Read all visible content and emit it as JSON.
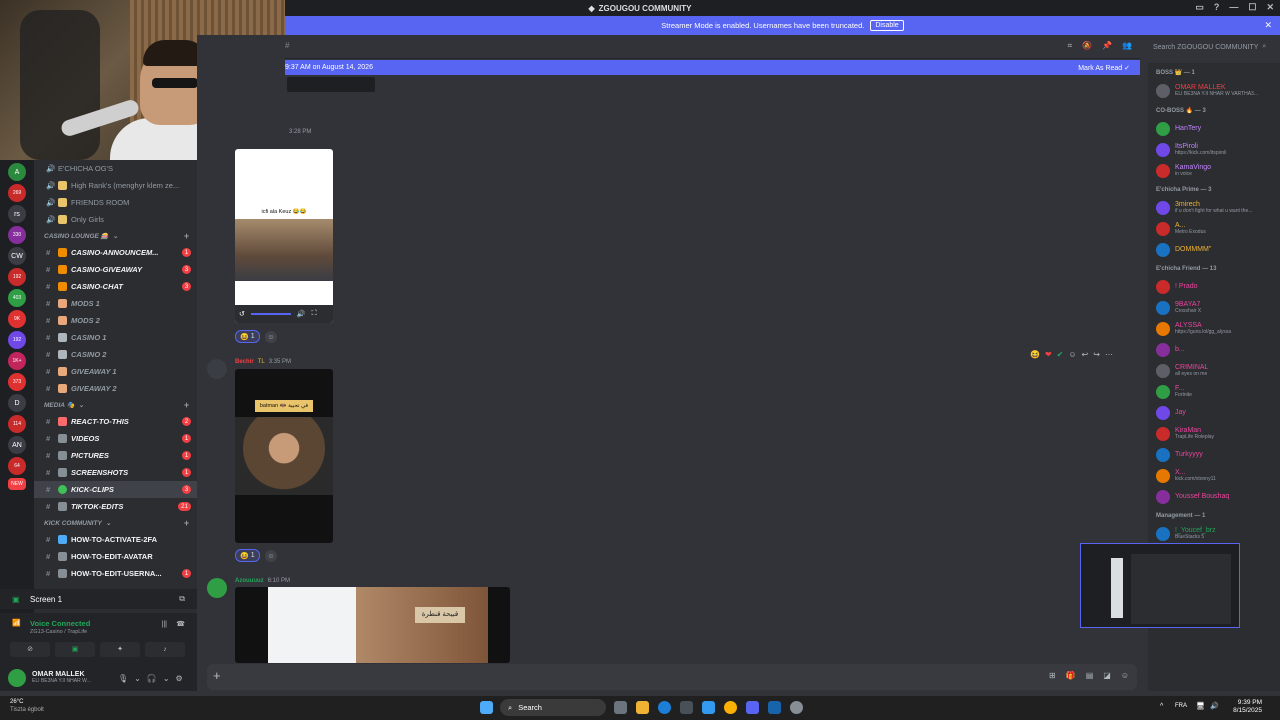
{
  "window": {
    "title": "ZGOUGOU COMMUNITY"
  },
  "streamer_banner": {
    "text": "Streamer Mode is enabled. Usernames have been truncated.",
    "button": "Disable"
  },
  "header": {
    "search_placeholder": "Search ZGOUGOU COMMUNITY"
  },
  "new_messages": {
    "text": "9:37 AM on August 14, 2026",
    "mark_read": "Mark As Read"
  },
  "channels": {
    "top": [
      {
        "label": "E'CHICHA OG'S"
      },
      {
        "label": "High Rank's (menghyr klem ze..."
      },
      {
        "label": "FRIENDS ROOM"
      },
      {
        "label": "Only Girls"
      }
    ],
    "casino_category": "CASINO LOUNGE 🎰",
    "casino": [
      {
        "label": "CASINO-ANNOUNCEM...",
        "badge": "1"
      },
      {
        "label": "CASINO-GIVEAWAY",
        "badge": "3"
      },
      {
        "label": "CASINO-CHAT",
        "badge": "3"
      },
      {
        "label": "MODS 1"
      },
      {
        "label": "MODS 2"
      },
      {
        "label": "CASINO 1"
      },
      {
        "label": "CASINO 2"
      },
      {
        "label": "GIVEAWAY 1"
      },
      {
        "label": "GIVEAWAY 2"
      }
    ],
    "media_category": "MEDIA 🎭",
    "media": [
      {
        "label": "REACT-TO-THIS",
        "badge": "2"
      },
      {
        "label": "VIDEOS",
        "badge": "1"
      },
      {
        "label": "PICTURES",
        "badge": "1"
      },
      {
        "label": "SCREENSHOTS",
        "badge": "1"
      },
      {
        "label": "KICK-CLIPS",
        "badge": "3"
      },
      {
        "label": "TIKTOK-EDITS",
        "badge": "21"
      }
    ],
    "kick_category": "KICK COMMUNITY",
    "kick": [
      {
        "label": "HOW-TO-ACTIVATE-2FA"
      },
      {
        "label": "HOW-TO-EDIT-AVATAR"
      },
      {
        "label": "HOW-TO-EDIT-USERNA...",
        "badge": "1"
      }
    ]
  },
  "guild_badges": [
    "269",
    "330",
    "192",
    "403",
    "9K",
    "192",
    "1K+",
    "373",
    "114",
    "64",
    "NEW"
  ],
  "guild_letters": [
    "rs",
    "CW",
    "D",
    "AN"
  ],
  "screen_share": {
    "label": "Screen 1"
  },
  "voice": {
    "status": "Voice Connected",
    "channel": "ZG13-Casino / TrapLife"
  },
  "user": {
    "name": "OMAR MALLEK",
    "status": "ELI BE3NA Y.II NHAR W..."
  },
  "messages": [
    {
      "time": "3:28 PM",
      "image_caption": "icfi ala Keuz 😂😂",
      "reaction_count": "1"
    },
    {
      "author": "Bechir",
      "tag": "TL",
      "time": "3:35 PM",
      "image_caption": "batman 🦇 في تحيية",
      "reaction_count": "1"
    },
    {
      "author": "Azouuuuz",
      "time": "6:10 PM",
      "image_caption": "قبيحة قنطرة"
    }
  ],
  "members": {
    "groups": [
      {
        "title": "BOSS 👑 — 1",
        "items": [
          {
            "name": "OMAR MALLEK",
            "status": "ELI BE3NA Y.II NHAR W VARTHA3...",
            "color": "#f23f43"
          }
        ]
      },
      {
        "title": "CO-BOSS 🔥 — 3",
        "items": [
          {
            "name": "HanTery",
            "status": "",
            "color": "#c084fc"
          },
          {
            "name": "ItsPiroli",
            "status": "https://kick.com/itspiroli",
            "color": "#c084fc"
          },
          {
            "name": "KamaVingo",
            "status": "in voice",
            "color": "#c084fc"
          }
        ]
      },
      {
        "title": "E'chicha Prime — 3",
        "items": [
          {
            "name": "3mirech",
            "status": "if u don't fight for what u want the...",
            "color": "#f0b232"
          },
          {
            "name": "A...",
            "status": "Metro Exodus",
            "color": "#f0b232"
          },
          {
            "name": "DOMMMM\"",
            "status": "",
            "color": "#f0b232"
          }
        ]
      },
      {
        "title": "E'chicha Friend — 13",
        "items": [
          {
            "name": "! Prado",
            "status": "",
            "color": "#eb459e"
          },
          {
            "name": "9BAYA7",
            "status": "Crosshair X",
            "color": "#eb459e"
          },
          {
            "name": "ALYSSA",
            "status": "https://guns.lol/gg_alyssa",
            "color": "#eb459e"
          },
          {
            "name": "b...",
            "status": "",
            "color": "#eb459e"
          },
          {
            "name": "CRIMINAL",
            "status": "all eyes on me",
            "color": "#eb459e"
          },
          {
            "name": "F...",
            "status": "Fortnite",
            "color": "#eb459e"
          },
          {
            "name": "Jay",
            "status": "",
            "color": "#eb459e"
          },
          {
            "name": "KiraMan",
            "status": "TrapLife Roleplay",
            "color": "#eb459e"
          },
          {
            "name": "Turkyyyy",
            "status": "",
            "color": "#eb459e"
          },
          {
            "name": "X...",
            "status": "kick.com/xtonny11",
            "color": "#eb459e"
          },
          {
            "name": "Youssef Boushaq",
            "status": "",
            "color": "#eb459e"
          }
        ]
      },
      {
        "title": "Management — 1",
        "items": [
          {
            "name": "!_Youcef_brz",
            "status": "BlueStacks 5",
            "color": "#23a55a"
          }
        ]
      }
    ]
  },
  "taskbar": {
    "search": "Search",
    "weather_temp": "26°C",
    "weather_desc": "Tiszta égbolt",
    "lang": "FRA",
    "time": "9:39 PM",
    "date": "8/15/2025"
  },
  "accent": "#5865f2"
}
